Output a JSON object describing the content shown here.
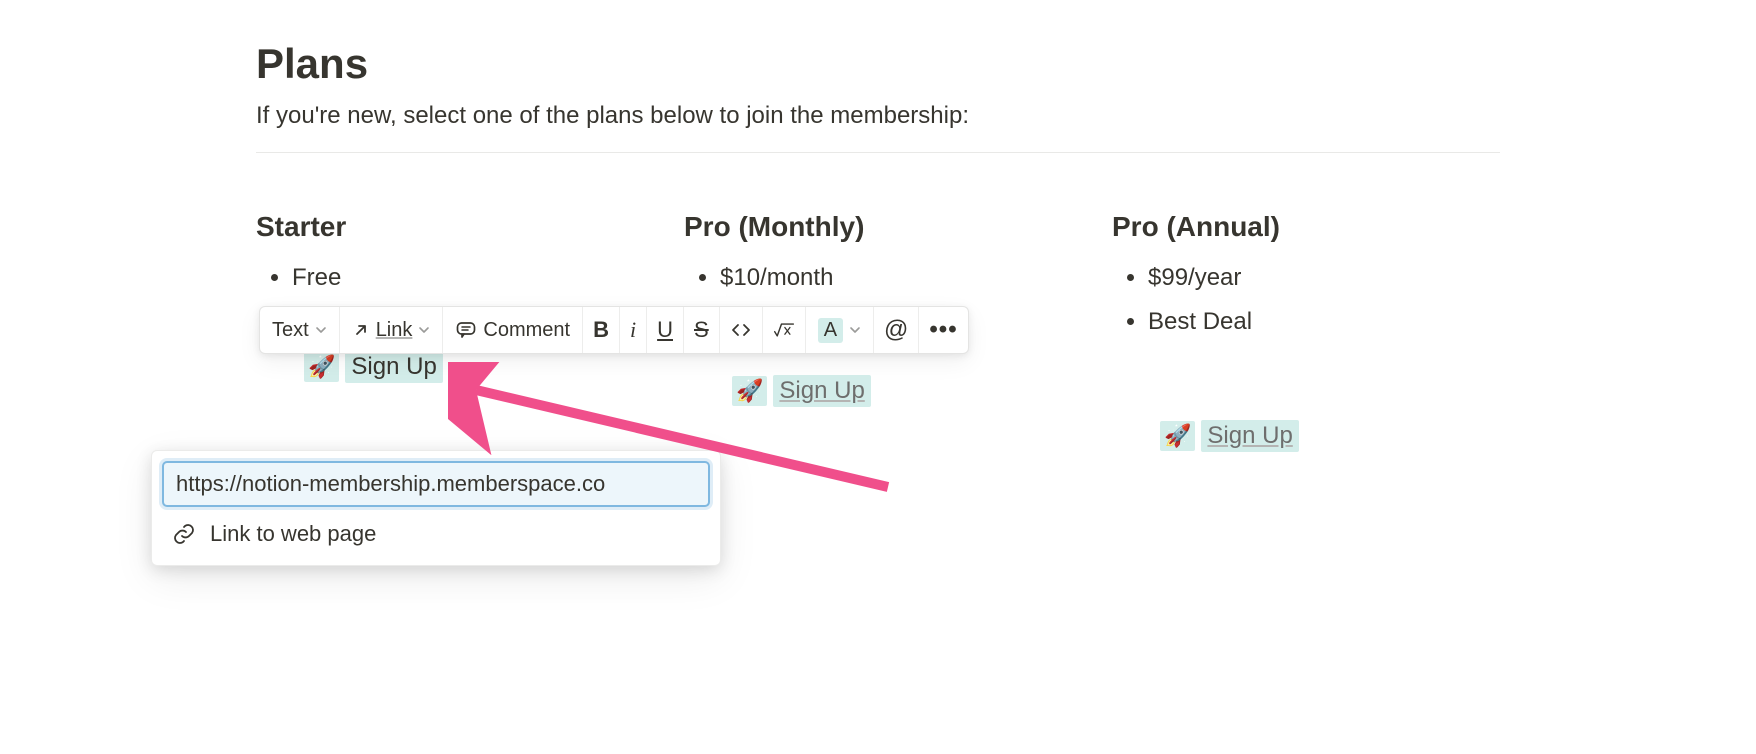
{
  "page": {
    "title": "Plans",
    "description": "If you're new, select one of the plans below to join the membership:"
  },
  "columns": [
    {
      "title": "Starter",
      "bullets": [
        "Free"
      ],
      "signup_label": "Sign Up"
    },
    {
      "title": "Pro (Monthly)",
      "bullets": [
        "$10/month"
      ],
      "signup_label": "Sign Up"
    },
    {
      "title": "Pro (Annual)",
      "bullets": [
        "$99/year",
        "Best Deal"
      ],
      "signup_label": "Sign Up"
    }
  ],
  "toolbar": {
    "text_label": "Text",
    "link_label": "Link",
    "comment_label": "Comment",
    "bold": "B",
    "italic": "i",
    "underline": "U",
    "strike": "S",
    "color_letter": "A",
    "mention": "@",
    "more": "•••"
  },
  "link_popup": {
    "input_value": "https://notion-membership.memberspace.co",
    "option_label": "Link to web page"
  },
  "icons": {
    "rocket": "🚀"
  }
}
